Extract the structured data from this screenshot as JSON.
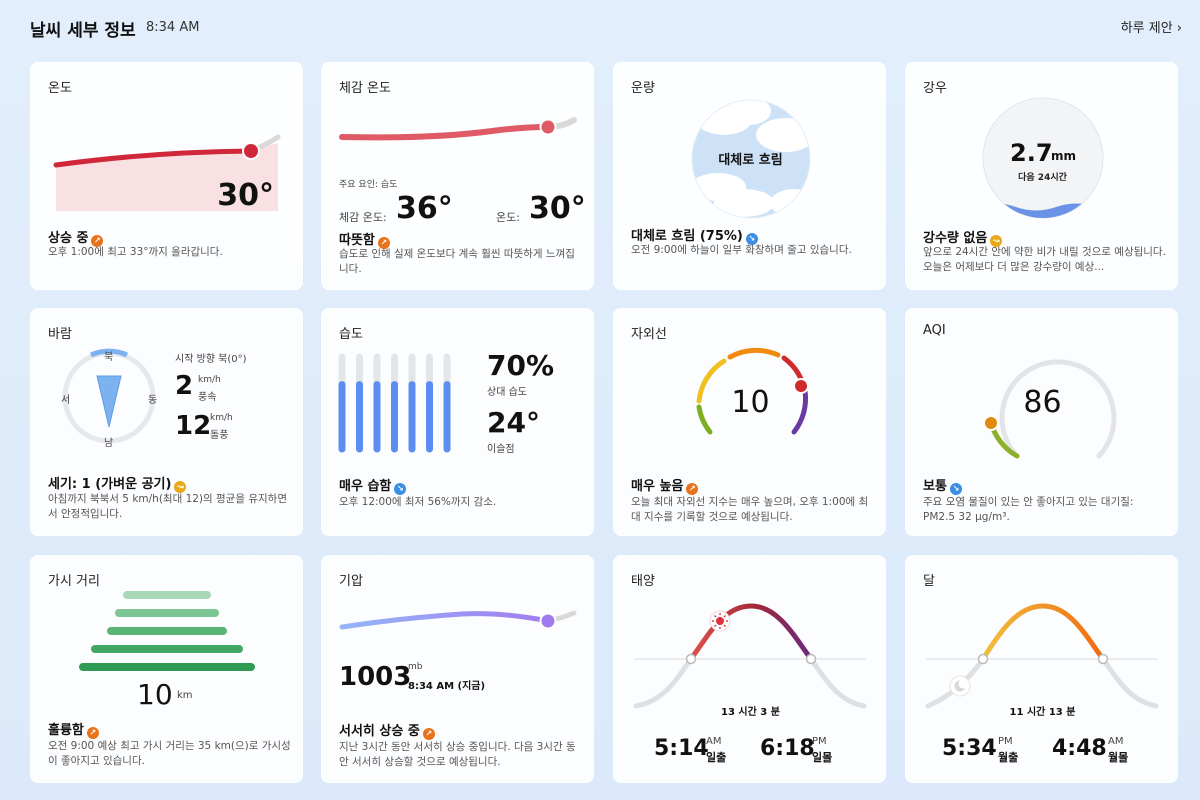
{
  "header": {
    "title": "날씨 세부 정보",
    "time": "8:34 AM",
    "suggest": "하루 제안 ›"
  },
  "temperature": {
    "title": "온도",
    "value": "30°",
    "status": "상승 중",
    "desc": "오후 1:00에 최고 33°까지 올라갑니다."
  },
  "feels": {
    "title": "체감 온도",
    "factor": "주요 요인: 습도",
    "feels_label": "체감 온도:",
    "feels_value": "36°",
    "temp_label": "온도:",
    "temp_value": "30°",
    "status": "따뜻함",
    "desc": "습도로 인해 실제 온도보다 계속 훨씬 따뜻하게 느껴집니다."
  },
  "cloud": {
    "title": "운량",
    "center": "대체로 흐림",
    "status": "대체로 흐림 (75%)",
    "desc": "오전 9:00에 하늘이 일부 화창하며 줄고 있습니다.",
    "percent": 75
  },
  "rain": {
    "title": "강우",
    "amount": "2.7",
    "unit": "mm",
    "period": "다음 24시간",
    "status": "강수량 없음",
    "desc": "앞으로 24시간 안에 약한 비가 내릴 것으로 예상됩니다. 오늘은 어제보다 더 많은 강수량이 예상..."
  },
  "wind": {
    "title": "바람",
    "north": "북",
    "south": "남",
    "west": "서",
    "east": "동",
    "direction": "시작 방향 북(0°)",
    "speed": "2",
    "speed_unit": "km/h",
    "speed_label": "풍속",
    "gust": "12",
    "gust_unit": "km/h",
    "gust_label": "돌풍",
    "status": "세기: 1 (가벼운 공기)",
    "desc": "아침까지 북북서 5 km/h(최대 12)의 평균을 유지하면서 안정적입니다."
  },
  "humidity": {
    "title": "습도",
    "value": "70%",
    "value_label": "상대 습도",
    "dew": "24°",
    "dew_label": "이슬점",
    "status": "매우 습함",
    "desc": "오후 12:00에 최저 56%까지 감소.",
    "levels": [
      0.7,
      0.7,
      0.7,
      0.7,
      0.7,
      0.7,
      0.7
    ]
  },
  "uv": {
    "title": "자외선",
    "value": "10",
    "status": "매우 높음",
    "desc": "오늘 최대 자외선 지수는 매우 높으며, 오후 1:00에 최대 지수를 기록할 것으로 예상됩니다."
  },
  "aqi": {
    "title": "AQI",
    "value": "86",
    "status": "보통",
    "desc": "주요 오염 물질이 있는 안 좋아지고 있는 대기질: PM2.5 32 µg/m³."
  },
  "visibility": {
    "title": "가시 거리",
    "value": "10",
    "unit": "km",
    "status": "훌륭함",
    "desc": "오전 9:00 예상 최고 가시 거리는 35 km(으)로 가시성이 좋아지고 있습니다."
  },
  "pressure": {
    "title": "기압",
    "value": "1003",
    "unit": "mb",
    "time": "8:34 AM (지금)",
    "status": "서서히 상승 중",
    "desc": "지난 3시간 동안 서서히 상승 중입니다. 다음 3시간 동안 서서히 상승할 것으로 예상됩니다."
  },
  "sun": {
    "title": "태양",
    "duration": "13 시간 3 분",
    "rise_time": "5:14",
    "rise_ampm": "AM",
    "rise_label": "일출",
    "set_time": "6:18",
    "set_ampm": "PM",
    "set_label": "일몰"
  },
  "moon": {
    "title": "달",
    "duration": "11 시간 13 분",
    "rise_time": "5:34",
    "rise_ampm": "PM",
    "rise_label": "월출",
    "set_time": "4:48",
    "set_ampm": "AM",
    "set_label": "월몰"
  },
  "colors": {
    "temp_red": "#d0283a",
    "feels_red": "#e05a66",
    "pressure_purple": "#a37bf0",
    "humidity_blue": "#5b8ef0",
    "uv_yellow": "#f0c020",
    "uv_orange": "#f08a10",
    "uv_red": "#d02a2a",
    "uv_purple": "#6a3aa0",
    "uv_green": "#7cb020",
    "aqi_orange": "#e08a10",
    "vis_green": "#2e9a52"
  }
}
